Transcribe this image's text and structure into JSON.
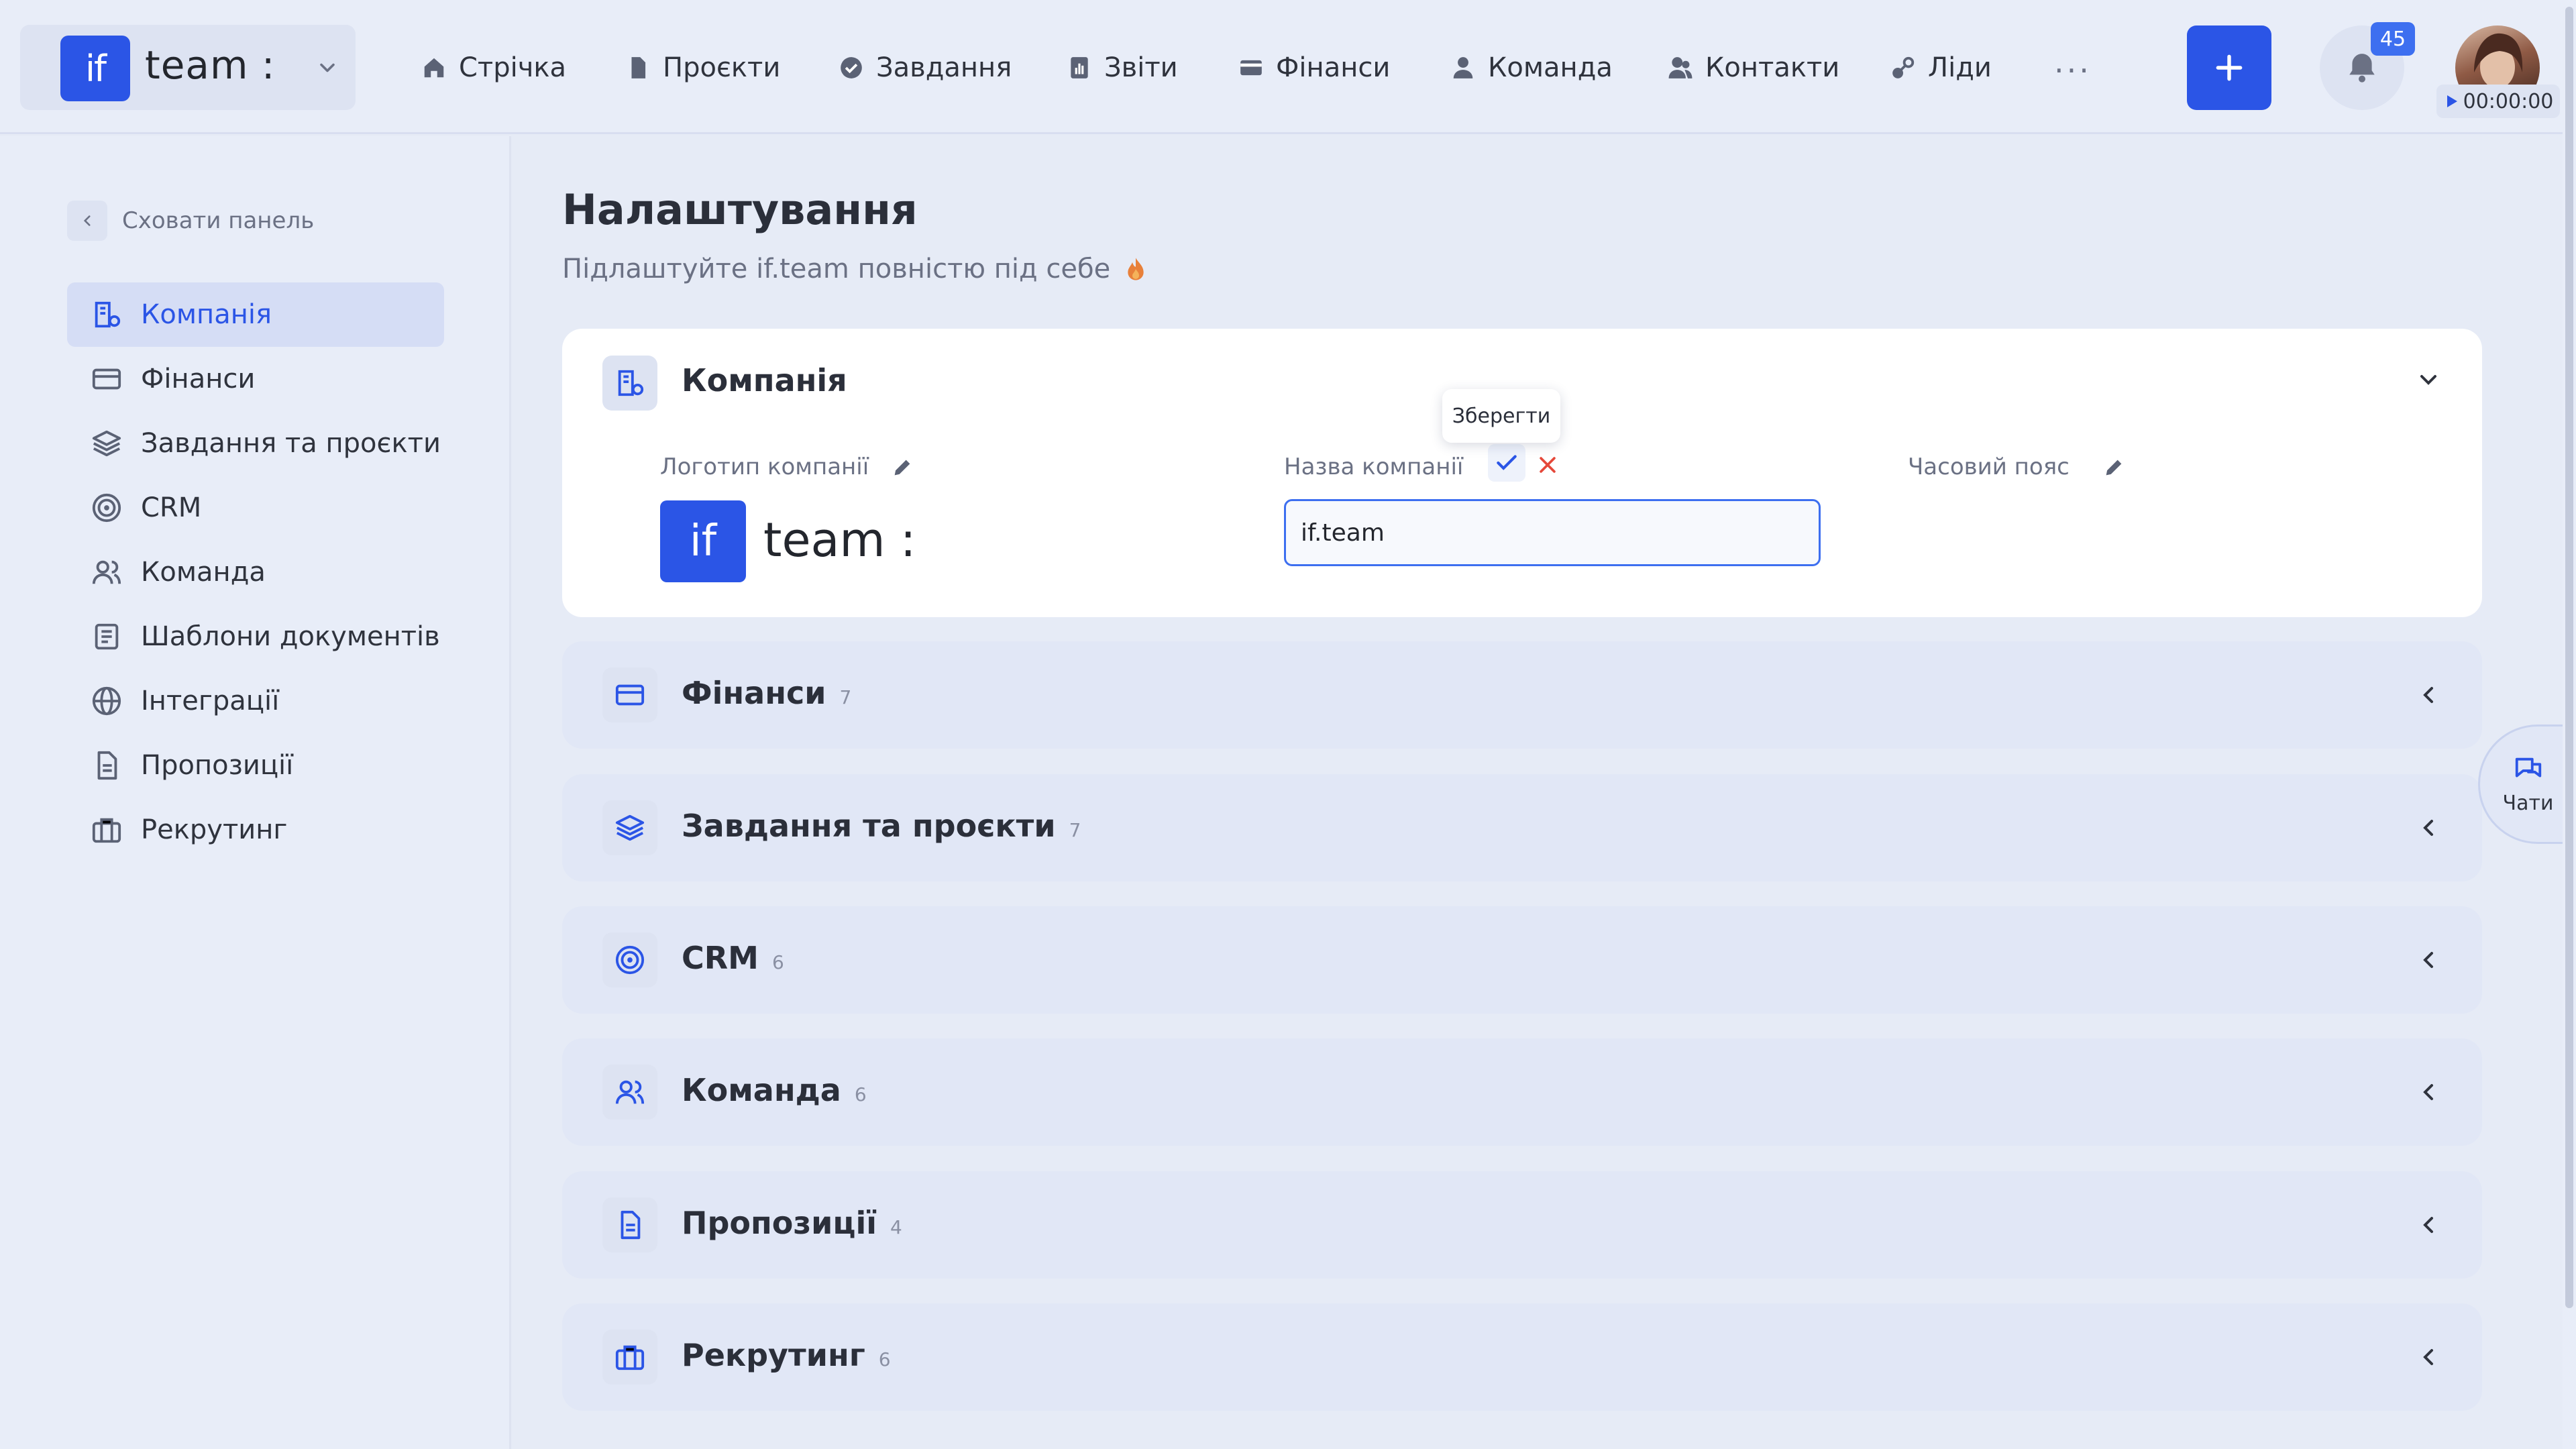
{
  "header": {
    "brand": {
      "logo_text": "if",
      "name": "team :"
    },
    "nav": [
      {
        "label": "Стрічка",
        "icon": "home-icon"
      },
      {
        "label": "Проєкти",
        "icon": "file-icon"
      },
      {
        "label": "Завдання",
        "icon": "check-circle-icon"
      },
      {
        "label": "Звіти",
        "icon": "chart-icon"
      },
      {
        "label": "Фінанси",
        "icon": "wallet-icon"
      },
      {
        "label": "Команда",
        "icon": "user-icon"
      },
      {
        "label": "Контакти",
        "icon": "contacts-icon"
      },
      {
        "label": "Ліди",
        "icon": "leads-icon"
      }
    ],
    "more": "···",
    "notifications_count": "45",
    "timer": "00:00:00"
  },
  "sidebar": {
    "hide_label": "Сховати панель",
    "items": [
      {
        "label": "Компанія",
        "icon": "company-icon",
        "active": true
      },
      {
        "label": "Фінанси",
        "icon": "card-icon"
      },
      {
        "label": "Завдання та проєкти",
        "icon": "layers-icon"
      },
      {
        "label": "CRM",
        "icon": "target-icon"
      },
      {
        "label": "Команда",
        "icon": "team-icon"
      },
      {
        "label": "Шаблони документів",
        "icon": "template-icon"
      },
      {
        "label": "Інтеграції",
        "icon": "globe-icon"
      },
      {
        "label": "Пропозиції",
        "icon": "document-icon"
      },
      {
        "label": "Рекрутинг",
        "icon": "briefcase-icon"
      }
    ]
  },
  "main": {
    "title": "Налаштування",
    "subtitle": "Підлаштуйте if.team повністю під себе",
    "company_card": {
      "title": "Компанія",
      "logo_label": "Логотип компанії",
      "logo_text": "if",
      "logo_name": "team :",
      "name_label": "Назва компанії",
      "name_value": "if.team",
      "timezone_label": "Часовий пояс",
      "tooltip": "Зберегти"
    },
    "sections": [
      {
        "title": "Фінанси",
        "count": "7",
        "icon": "card-icon"
      },
      {
        "title": "Завдання та проєкти",
        "count": "7",
        "icon": "layers-icon"
      },
      {
        "title": "CRM",
        "count": "6",
        "icon": "target-icon"
      },
      {
        "title": "Команда",
        "count": "6",
        "icon": "team-icon"
      },
      {
        "title": "Пропозиції",
        "count": "4",
        "icon": "document-icon"
      },
      {
        "title": "Рекрутинг",
        "count": "6",
        "icon": "briefcase-icon"
      }
    ]
  },
  "chats_label": "Чати",
  "colors": {
    "accent": "#2b55e6",
    "background": "#e6ebf6",
    "danger": "#e5483a"
  }
}
